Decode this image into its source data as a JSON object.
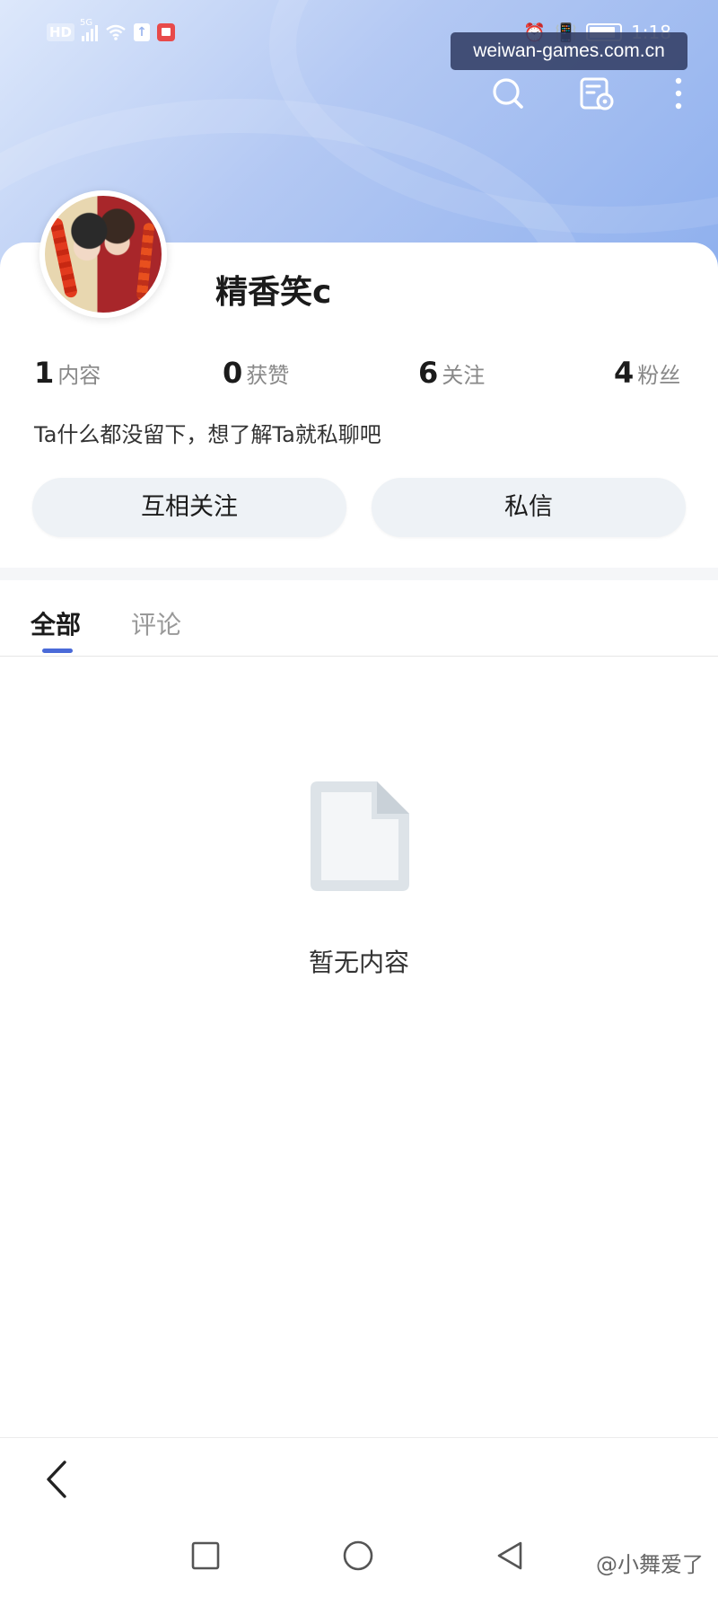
{
  "status_bar": {
    "hd_label": "HD",
    "signal_label": "5G",
    "time": "1:18"
  },
  "watermark": "weiwan-games.com.cn",
  "profile": {
    "username": "精香笑c",
    "bio": "Ta什么都没留下，想了解Ta就私聊吧",
    "stats": [
      {
        "value": "1",
        "label": "内容"
      },
      {
        "value": "0",
        "label": "获赞"
      },
      {
        "value": "6",
        "label": "关注"
      },
      {
        "value": "4",
        "label": "粉丝"
      }
    ]
  },
  "actions": {
    "follow_label": "互相关注",
    "message_label": "私信"
  },
  "tabs": [
    {
      "label": "全部",
      "active": true
    },
    {
      "label": "评论",
      "active": false
    }
  ],
  "empty_state": {
    "text": "暂无内容",
    "icon": "document-icon"
  },
  "icons": {
    "search": "search-icon",
    "scan": "scan-icon",
    "more": "more-vertical-icon",
    "back": "back-icon"
  },
  "credit": "@小舞爱了",
  "colors": {
    "accent": "#4a6ad8",
    "header_start": "#dde8fb",
    "header_end": "#8fb0ee"
  }
}
